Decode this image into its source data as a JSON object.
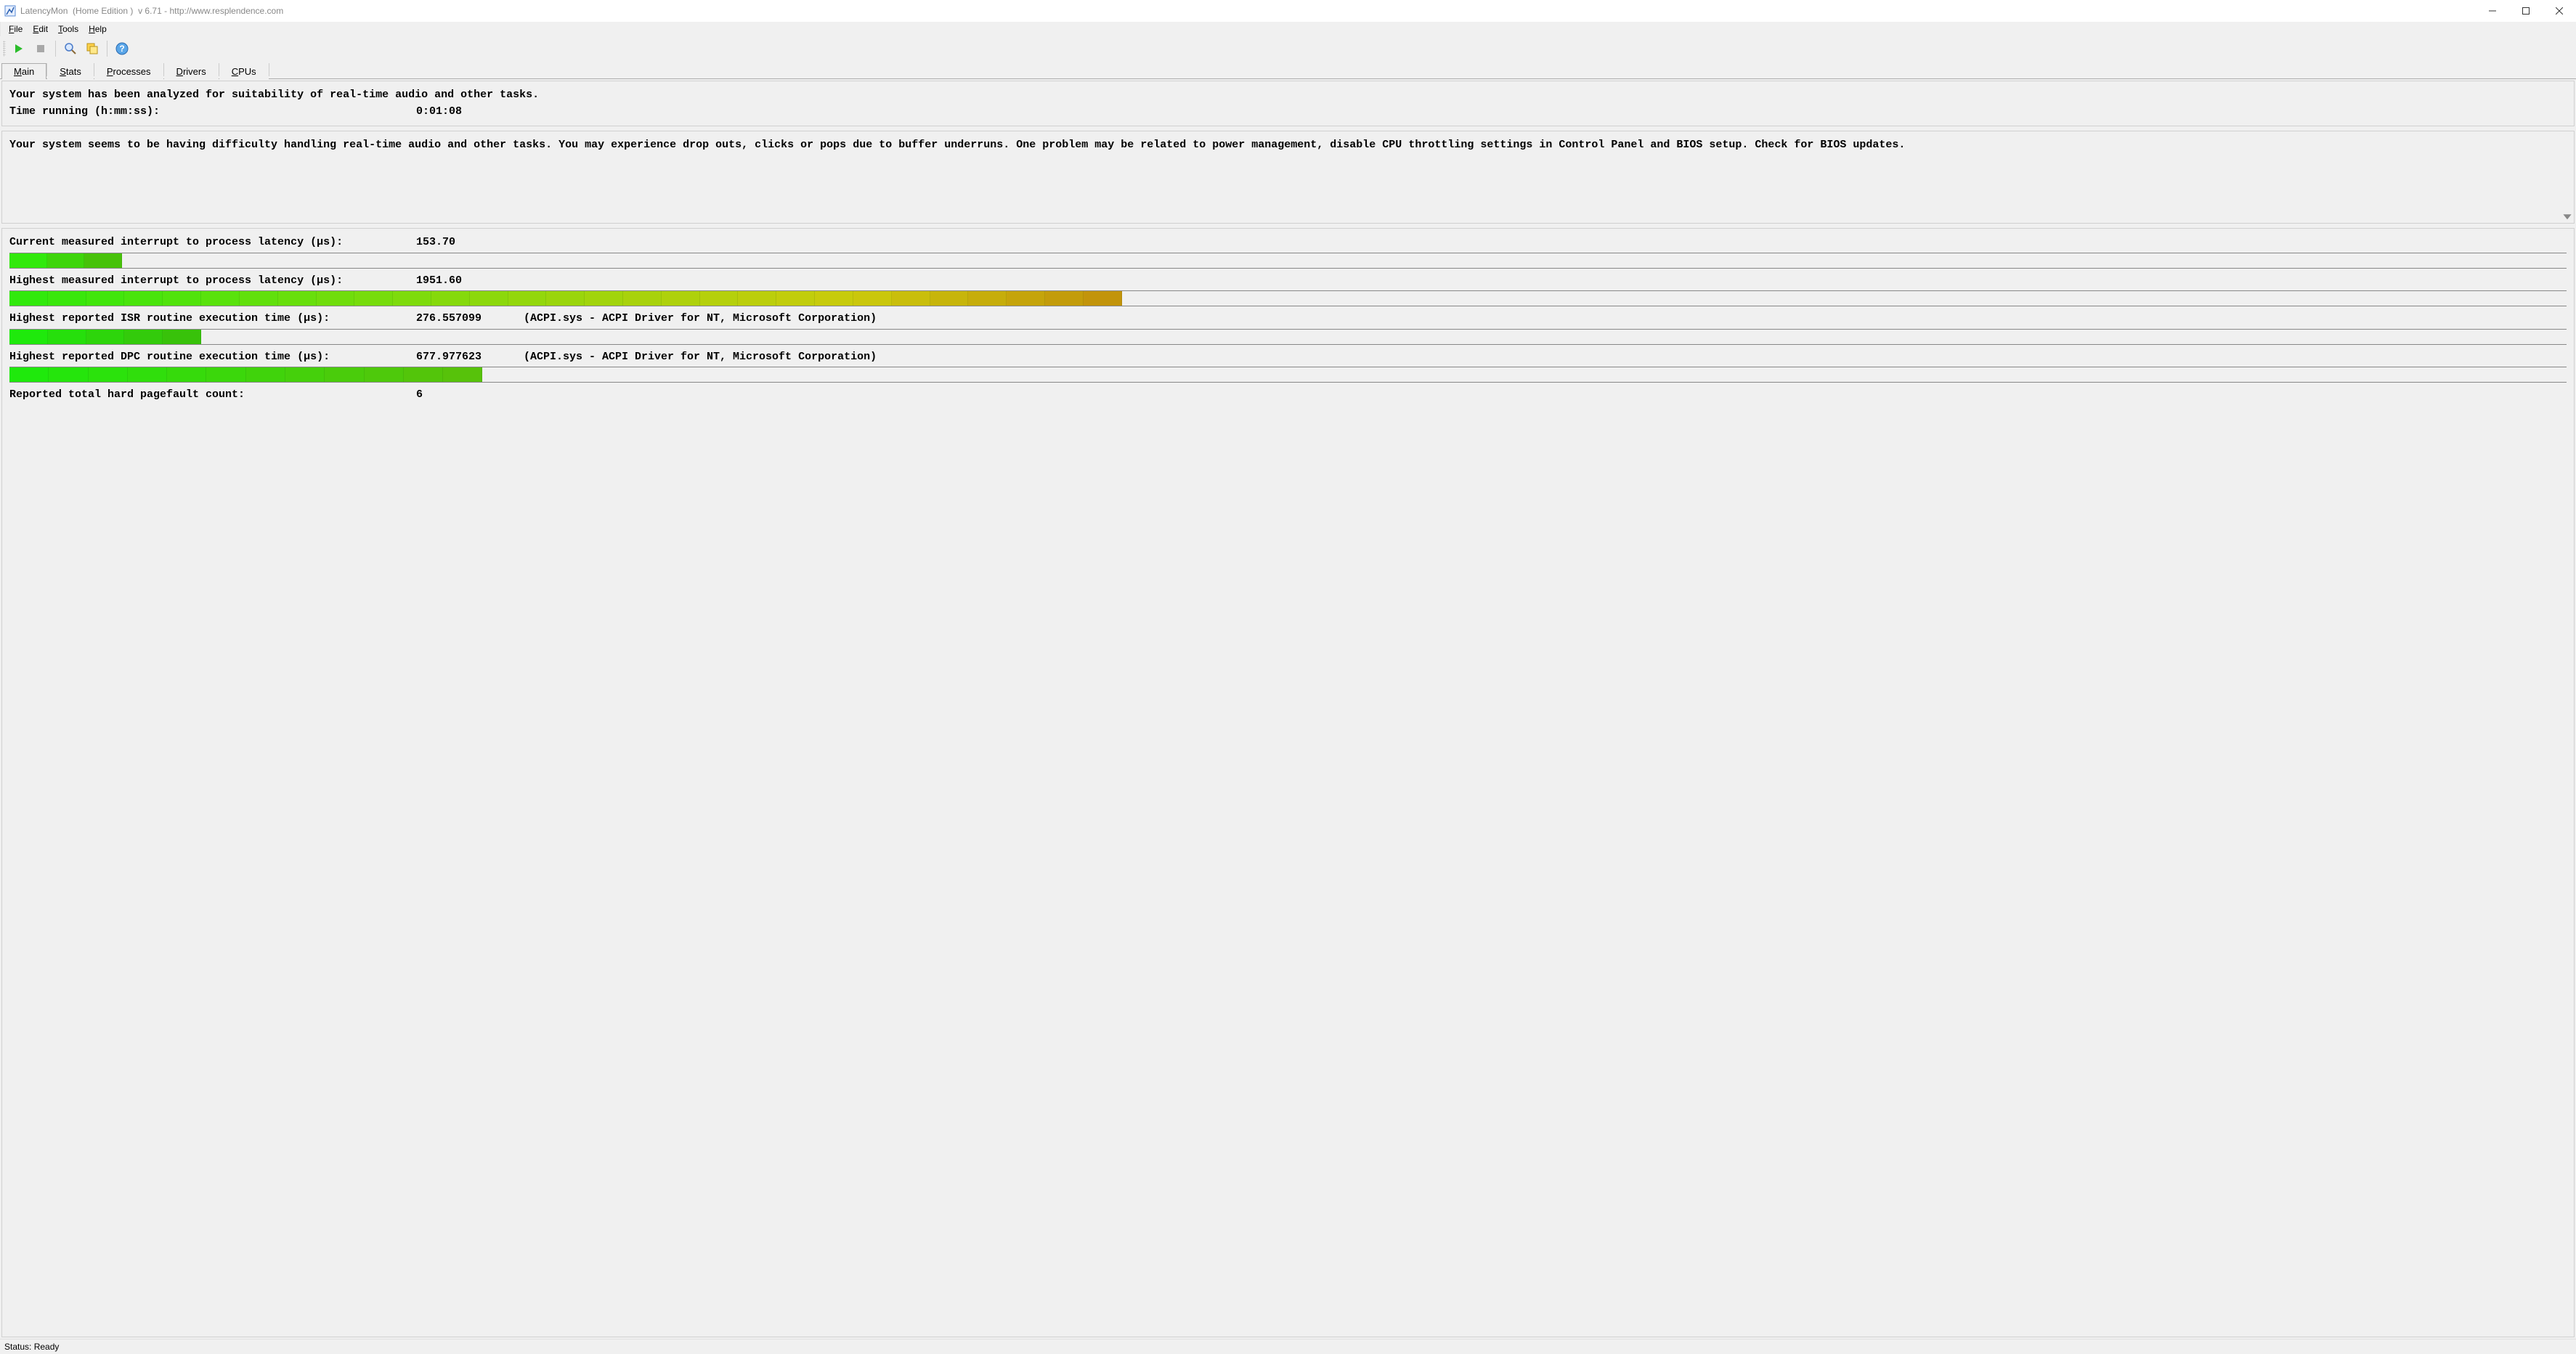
{
  "window": {
    "title_app": "LatencyMon",
    "title_edition": "(Home Edition )",
    "title_version": "v 6.71",
    "title_url": "http://www.resplendence.com"
  },
  "menus": {
    "file": "File",
    "edit": "Edit",
    "tools": "Tools",
    "help": "Help"
  },
  "toolbar": {
    "play": "play-icon",
    "stop": "stop-icon",
    "analyze": "analyze-icon",
    "copy": "copy-icon",
    "help": "help-icon"
  },
  "tabs": {
    "main": "Main",
    "stats": "Stats",
    "processes": "Processes",
    "drivers": "Drivers",
    "cpus": "CPUs",
    "active": "main"
  },
  "summary": {
    "line1": "Your system has been analyzed for suitability of real-time audio and other tasks.",
    "time_label": "Time running (h:mm:ss):",
    "time_value": "0:01:08"
  },
  "diagnosis": "Your system seems to be having difficulty handling real-time audio and other tasks. You may experience drop outs, clicks or pops due to buffer underruns. One problem may be related to power management, disable CPU throttling settings in Control Panel and BIOS setup. Check for BIOS updates.",
  "metrics": [
    {
      "label": "Current measured interrupt to process latency (µs):",
      "value": "153.70",
      "extra": "",
      "segments": 3,
      "width_pct": 4.4,
      "hue_start": 110,
      "hue_end": 100
    },
    {
      "label": "Highest measured interrupt to process latency (µs):",
      "value": "1951.60",
      "extra": "",
      "segments": 29,
      "width_pct": 43.5,
      "hue_start": 110,
      "hue_end": 45
    },
    {
      "label": "Highest reported ISR routine execution time (µs):",
      "value": "276.557099",
      "extra": "(ACPI.sys - ACPI Driver for NT, Microsoft Corporation)",
      "segments": 5,
      "width_pct": 7.5,
      "hue_start": 115,
      "hue_end": 105
    },
    {
      "label": "Highest reported DPC routine execution time (µs):",
      "value": "677.977623",
      "extra": "(ACPI.sys - ACPI Driver for NT, Microsoft Corporation)",
      "segments": 12,
      "width_pct": 18.5,
      "hue_start": 115,
      "hue_end": 95
    }
  ],
  "pagefault": {
    "label": "Reported total hard pagefault count:",
    "value": "6"
  },
  "status": {
    "text": "Status: Ready"
  }
}
